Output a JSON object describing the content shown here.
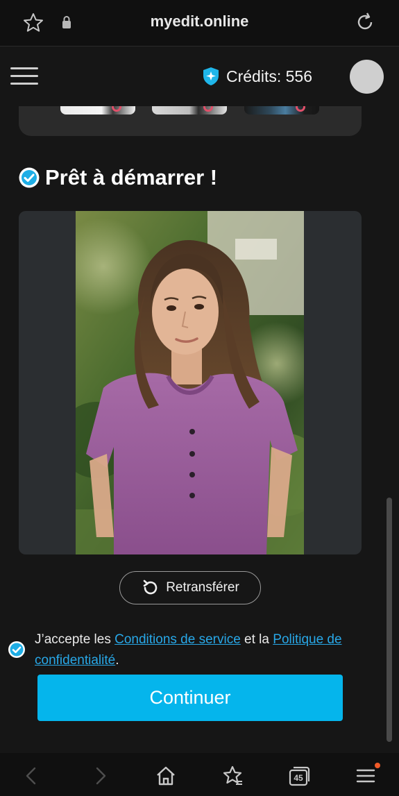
{
  "browser": {
    "url": "myedit.online"
  },
  "header": {
    "credits_label": "Crédits: 556"
  },
  "main": {
    "ready_title": "Prêt à démarrer !",
    "reupload_label": "Retransférer",
    "terms": {
      "prefix": "J’accepte les ",
      "terms_link": "Conditions de service",
      "middle": " et la ",
      "privacy_link": "Politique de confidentialité",
      "suffix": "."
    },
    "continue_label": "Continuer"
  },
  "bottom_nav": {
    "tabs_count": "45"
  },
  "colors": {
    "accent": "#05b5ec",
    "link": "#28a8e8",
    "background": "#161616"
  }
}
